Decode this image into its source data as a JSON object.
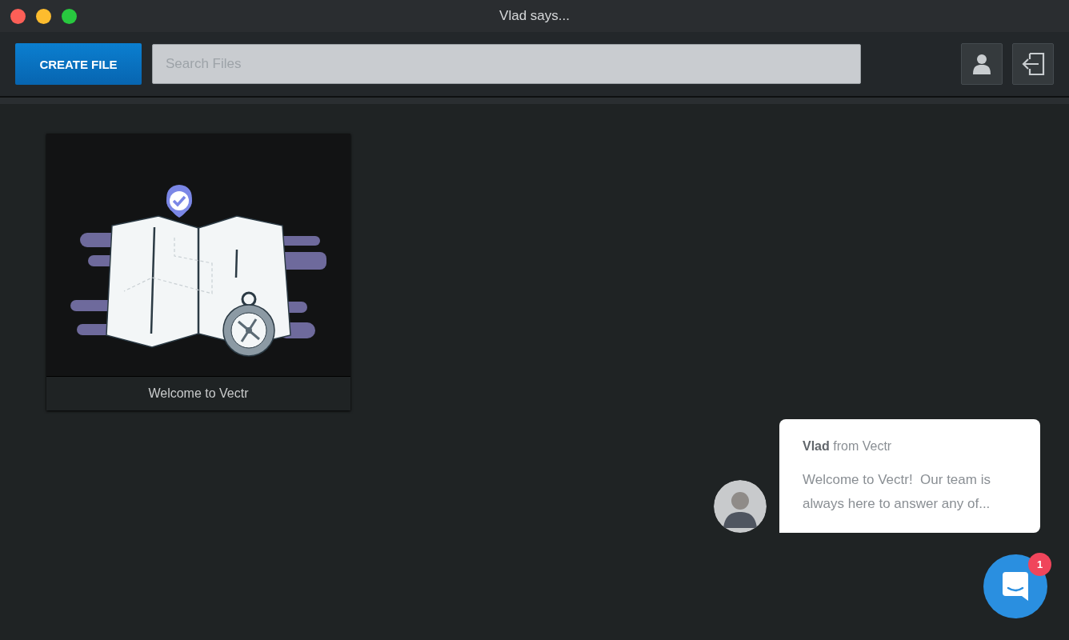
{
  "window": {
    "title": "Vlad says..."
  },
  "toolbar": {
    "create_button": "CREATE FILE",
    "search": {
      "placeholder": "Search Files"
    }
  },
  "files": [
    {
      "name": "Welcome to Vectr"
    }
  ],
  "chat_message": {
    "sender": "**Vlad** from Vectr",
    "body": "Welcome to Vectr!  Our team is always here to answer any of..."
  },
  "chat_launcher": {
    "badge": "1"
  }
}
